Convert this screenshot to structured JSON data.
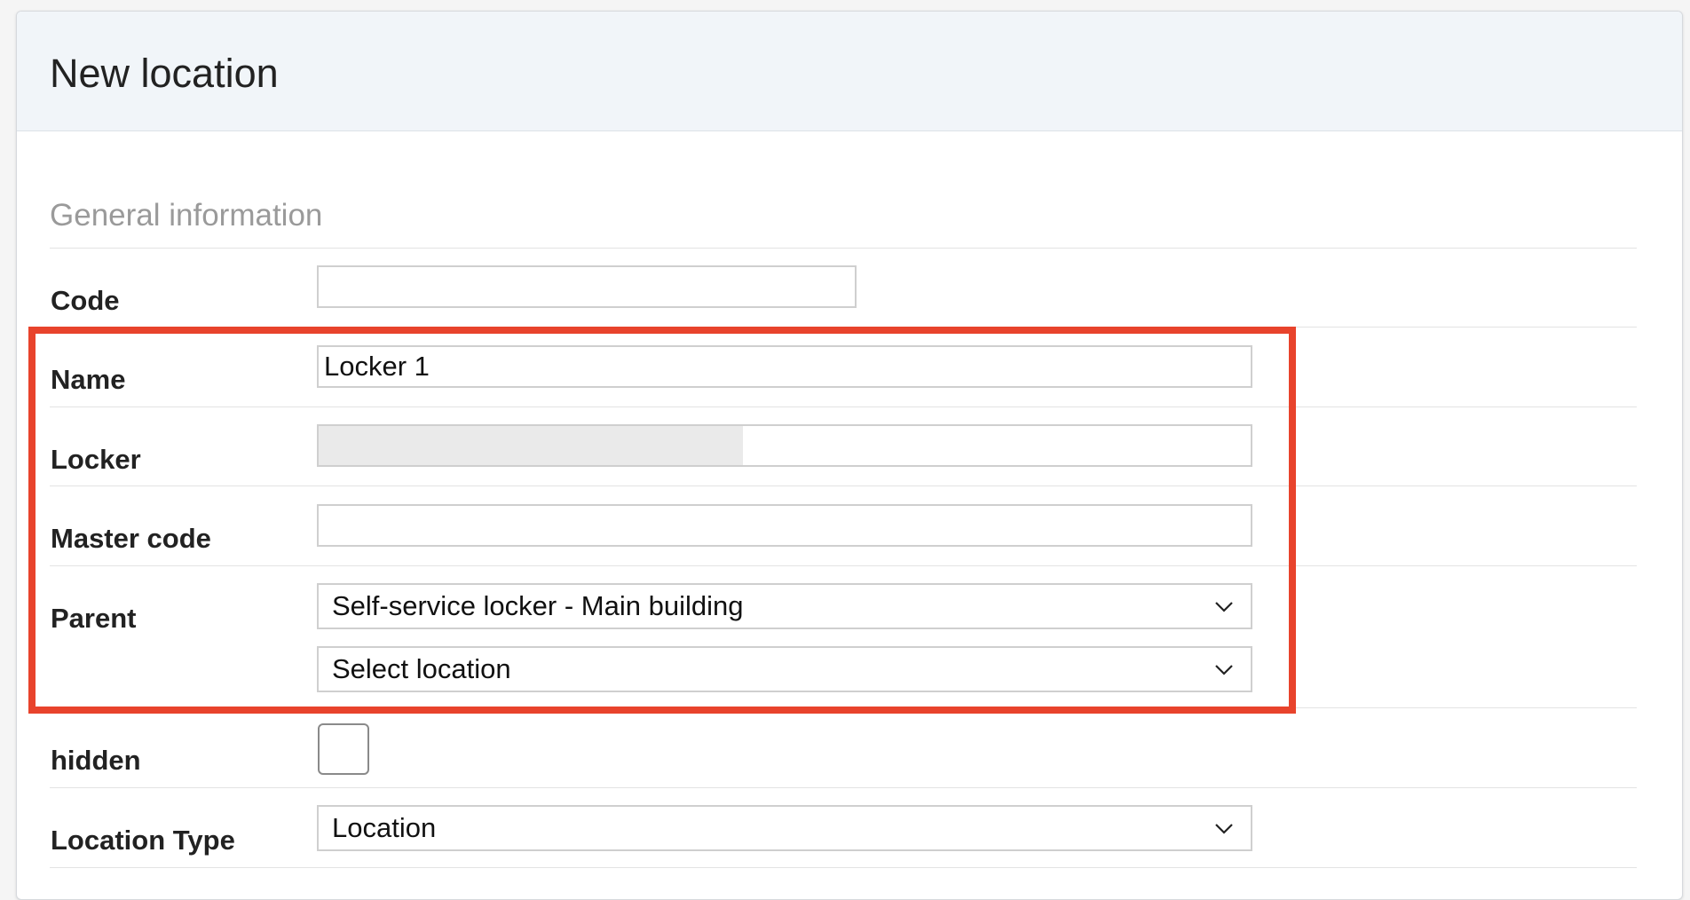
{
  "page": {
    "title": "New location",
    "section_title": "General information"
  },
  "form": {
    "code": {
      "label": "Code",
      "value": ""
    },
    "name": {
      "label": "Name",
      "value": "Locker 1"
    },
    "locker": {
      "label": "Locker",
      "fill_fraction": 0.455
    },
    "master_code": {
      "label": "Master code",
      "value": ""
    },
    "parent": {
      "label": "Parent",
      "selected": "Self-service locker - Main building",
      "sub_selected": "Select location"
    },
    "hidden": {
      "label": "hidden",
      "checked": false
    },
    "location_type": {
      "label": "Location Type",
      "selected": "Location"
    }
  },
  "colors": {
    "highlight": "#e8432c",
    "header_bg": "#f1f5f9",
    "section_title": "#9a9a9a"
  },
  "icons": {
    "dropdown": "chevron-down-icon"
  }
}
